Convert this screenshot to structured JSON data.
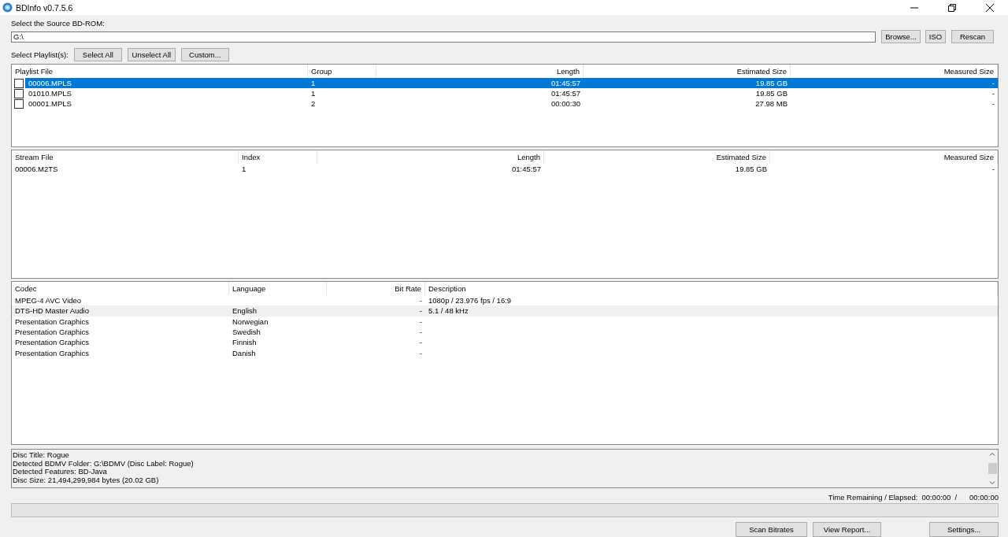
{
  "window": {
    "title": "BDInfo v0.7.5.6"
  },
  "source": {
    "label": "Select the Source BD-ROM:",
    "value": "G:\\",
    "buttons": [
      "Browse...",
      "ISO",
      "Rescan"
    ]
  },
  "playlist_select": {
    "label": "Select Playlist(s):",
    "buttons": [
      "Select All",
      "Unselect All",
      "Custom..."
    ]
  },
  "playlists": {
    "columns": [
      "Playlist File",
      "Group",
      "Length",
      "Estimated Size",
      "Measured Size"
    ],
    "rows": [
      {
        "cells": [
          "00006.MPLS",
          "1",
          "01:45:57",
          "19.85 GB",
          "-"
        ],
        "checked": false,
        "selected": true
      },
      {
        "cells": [
          "01010.MPLS",
          "1",
          "01:45:57",
          "19.85 GB",
          "-"
        ],
        "checked": false,
        "selected": false
      },
      {
        "cells": [
          "00001.MPLS",
          "2",
          "00:00:30",
          "27.98 MB",
          "-"
        ],
        "checked": false,
        "selected": false
      }
    ]
  },
  "streams": {
    "columns": [
      "Stream File",
      "Index",
      "Length",
      "Estimated Size",
      "Measured Size"
    ],
    "rows": [
      {
        "cells": [
          "00006.M2TS",
          "1",
          "01:45:57",
          "19.85 GB",
          "-"
        ],
        "selected": false
      }
    ]
  },
  "codecs": {
    "columns": [
      "Codec",
      "Language",
      "Bit Rate",
      "Description"
    ],
    "rows": [
      {
        "cells": [
          "MPEG-4 AVC Video",
          "",
          "-",
          "1080p / 23.976 fps / 16:9"
        ],
        "selected": false
      },
      {
        "cells": [
          "DTS-HD Master Audio",
          "English",
          "-",
          "5.1 / 48 kHz"
        ],
        "selected": true
      },
      {
        "cells": [
          "Presentation Graphics",
          "Norwegian",
          "-",
          ""
        ],
        "selected": false
      },
      {
        "cells": [
          "Presentation Graphics",
          "Swedish",
          "-",
          ""
        ],
        "selected": false
      },
      {
        "cells": [
          "Presentation Graphics",
          "Finnish",
          "-",
          ""
        ],
        "selected": false
      },
      {
        "cells": [
          "Presentation Graphics",
          "Danish",
          "-",
          ""
        ],
        "selected": false
      }
    ]
  },
  "log": [
    "Disc Title: Rogue",
    "Detected BDMV Folder: G:\\BDMV (Disc Label: Rogue)",
    "Detected Features: BD-Java",
    "Disc Size: 21,494,299,984 bytes (20.02 GB)"
  ],
  "time": {
    "label": "Time Remaining / Elapsed:",
    "remaining": "00:00:00",
    "separator": "/",
    "elapsed": "00:00:00"
  },
  "progress": {
    "level": 0
  },
  "buttons": [
    "Scan Bitrates",
    "View Report...",
    "Settings..."
  ]
}
